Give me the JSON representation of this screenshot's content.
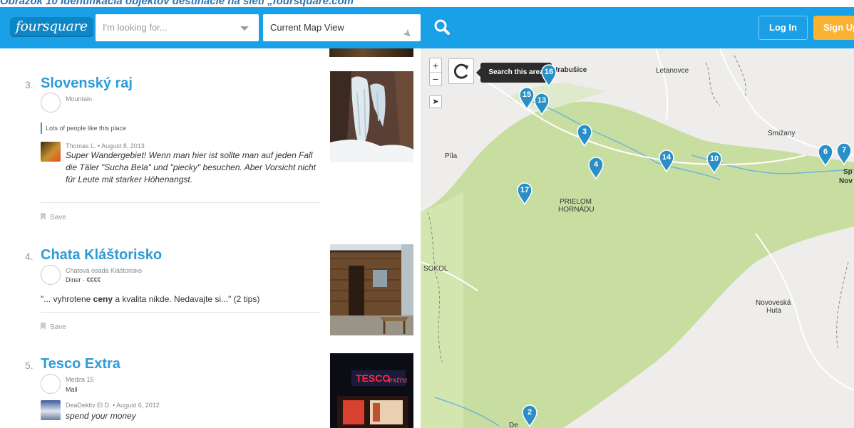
{
  "caption": "Obrázok 10 Identifikácia objektov destinácie na sieti „foursquare.com“",
  "header": {
    "logo": "foursquare",
    "search_placeholder": "I'm looking for...",
    "near_value": "Current Map View",
    "login_label": "Log In",
    "signup_label": "Sign Up"
  },
  "results": [
    {
      "number": "3.",
      "name": "Slovenský raj",
      "category": "Mountain",
      "likes": "Lots of people like this place",
      "tip_author": "Thomas L. • August 8, 2013",
      "tip_text": "Super Wandergebiet! Wenn man hier ist sollte man auf jeden Fall die Täler \"Sucha Bela\" und \"piecky\" besuchen. Aber Vorsicht nicht für Leute mit starker Höhenangst.",
      "save_label": "Save"
    },
    {
      "number": "4.",
      "name": "Chata Kláštorisko",
      "address": "Chatová osada Kláštorisko",
      "category": "Diner",
      "price": "€€€€",
      "tip_pre": "\"... vyhrotene ",
      "tip_bold": "ceny",
      "tip_post": " a kvalita nikde. Nedavajte si...\" (2 tips)",
      "save_label": "Save"
    },
    {
      "number": "5.",
      "name": "Tesco Extra",
      "address": "Medza 15",
      "category": "Mall",
      "tip_author": "DeaDektiv El D. • August 6, 2012",
      "tip_text": "spend your money"
    }
  ],
  "map": {
    "zoom_in": "+",
    "zoom_out": "−",
    "search_area_label": "Search this area",
    "places": {
      "hrabusice": "Hrabušice",
      "letanovce": "Letanovce",
      "smizany": "Smižany",
      "pila": "Píla",
      "prielom1": "PRIELOM",
      "prielom2": "HORNÁDU",
      "sokol": "SOKOL",
      "novoveska1": "Novoveská",
      "novoveska2": "Huta",
      "sp1": "Sp",
      "sp2": "Nov",
      "de": "De"
    },
    "pins": [
      "16",
      "15",
      "13",
      "3",
      "4",
      "14",
      "10",
      "17",
      "6",
      "7",
      "2"
    ],
    "colors": {
      "pin": "#2b8fc7",
      "forest": "#c8dea1",
      "water": "#6fb6d9"
    }
  },
  "photo_text": {
    "tesco": "TESCO",
    "extra": "extra"
  }
}
